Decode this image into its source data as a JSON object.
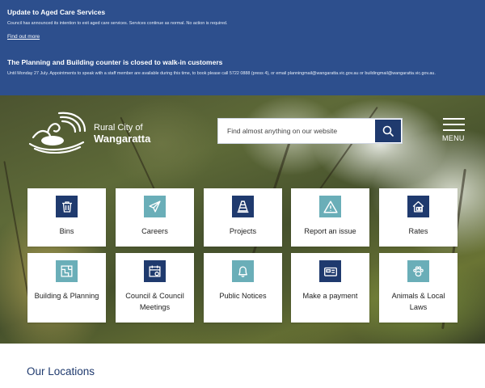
{
  "alerts": {
    "aged_care": {
      "title": "Update to Aged Care Services",
      "body": "Council has announced its intention to exit aged care services. Services continue as normal. No action is required.",
      "link": "Find out more"
    },
    "planning": {
      "title": "The Planning and Building counter is closed to walk-in customers",
      "body": "Until Monday 27 July. Appointments to speak with a staff member are available during this time, to book please call 5722 0888 (press 4), or email planningmail@wangaratta.vic.gov.au or buildingmail@wangaratta.vic.gov.au."
    }
  },
  "header": {
    "logo_line1": "Rural City of",
    "logo_line2": "Wangaratta",
    "search_placeholder": "Find almost anything on our website",
    "menu_label": "MENU"
  },
  "tiles": [
    {
      "label": "Bins",
      "icon": "bin-icon",
      "color": "#1f3a6e"
    },
    {
      "label": "Careers",
      "icon": "plane-icon",
      "color": "#6aaeb8"
    },
    {
      "label": "Projects",
      "icon": "traffic-cone-icon",
      "color": "#1f3a6e"
    },
    {
      "label": "Report an issue",
      "icon": "warning-icon",
      "color": "#6aaeb8"
    },
    {
      "label": "Rates",
      "icon": "house-dollar-icon",
      "color": "#1f3a6e"
    },
    {
      "label": "Building & Planning",
      "icon": "blueprint-icon",
      "color": "#6aaeb8"
    },
    {
      "label": "Council & Council Meetings",
      "icon": "calendar-icon",
      "color": "#1f3a6e"
    },
    {
      "label": "Public Notices",
      "icon": "bell-icon",
      "color": "#6aaeb8"
    },
    {
      "label": "Make a payment",
      "icon": "card-reader-icon",
      "color": "#1f3a6e"
    },
    {
      "label": "Animals & Local Laws",
      "icon": "paw-icon",
      "color": "#6aaeb8"
    }
  ],
  "sections": {
    "locations_heading": "Our Locations"
  },
  "colors": {
    "alert_bg": "#2d4f8d",
    "navy": "#1f3a6e",
    "teal": "#6aaeb8"
  }
}
